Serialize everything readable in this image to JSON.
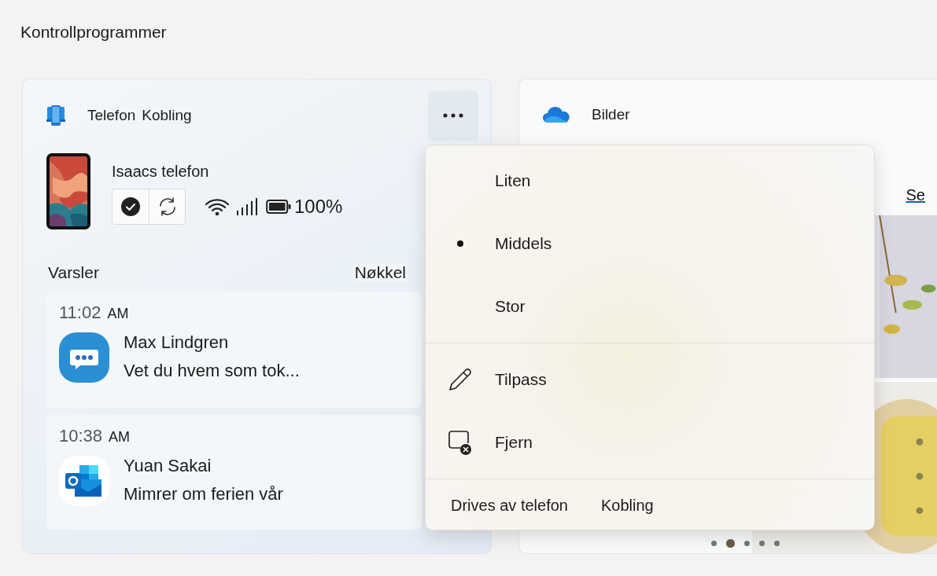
{
  "page_title": "Kontrollprogrammer",
  "phone_widget": {
    "app_name": [
      "Telefon",
      "Kobling"
    ],
    "device_name": "Isaacs telefon",
    "battery": "100%",
    "section_title": "Varsler",
    "section_action": "Nøkkel",
    "notifications": [
      {
        "kind": "messages",
        "time": "11:02",
        "period": "AM",
        "sender": "Max Lindgren",
        "message": "Vet du hvem som tok..."
      },
      {
        "kind": "mail",
        "time": "10:38",
        "period": "AM",
        "sender": "Yuan Sakai",
        "message": "Mimrer om ferien vår"
      }
    ]
  },
  "photos_widget": {
    "title": "Bilder",
    "link": "Se",
    "pages": [
      {
        "selected": false
      },
      {
        "selected": true
      },
      {
        "selected": false
      },
      {
        "selected": false
      },
      {
        "selected": false
      }
    ]
  },
  "menu": {
    "size_options": [
      {
        "label": "Liten",
        "selected": false
      },
      {
        "label": "Middels",
        "selected": true
      },
      {
        "label": "Stor",
        "selected": false
      }
    ],
    "actions": [
      {
        "kind": "edit",
        "label": "Tilpass"
      },
      {
        "kind": "remove",
        "label": "Fjern"
      }
    ],
    "footer": [
      "Drives av telefon",
      "Kobling"
    ]
  }
}
